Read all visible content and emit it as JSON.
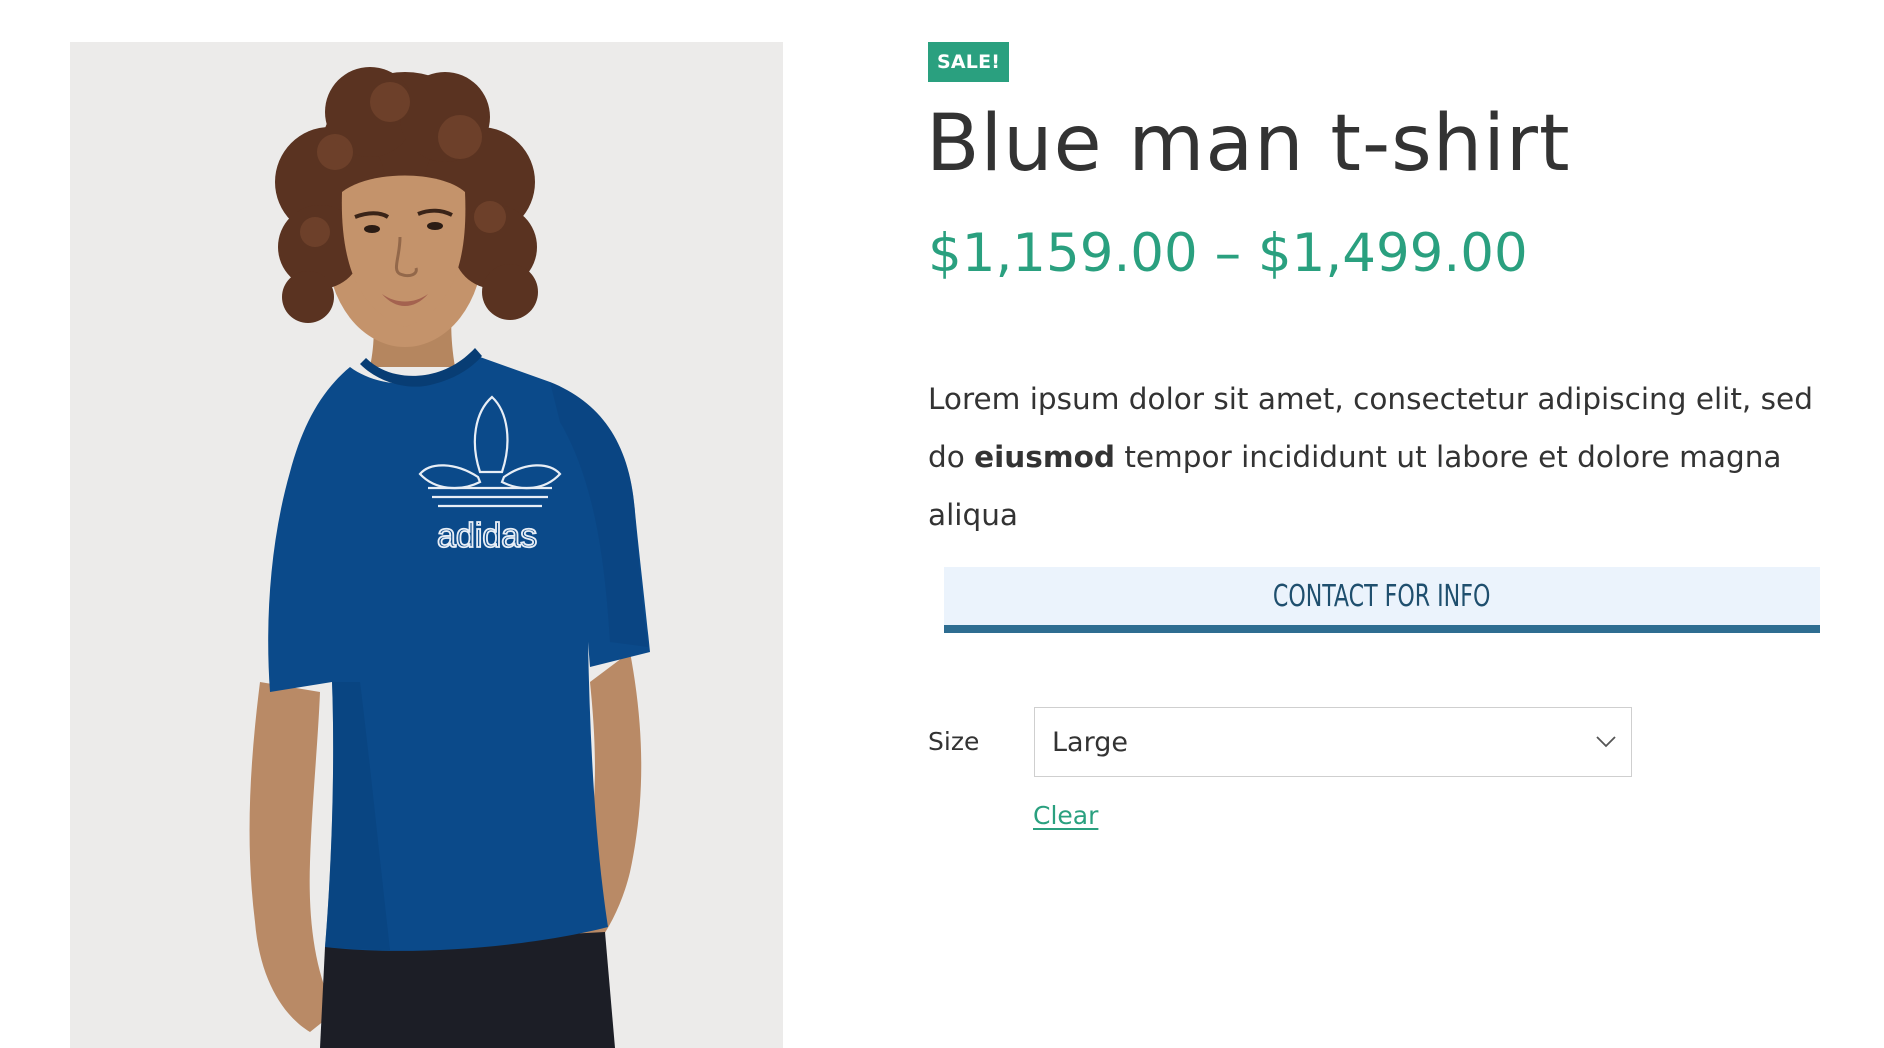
{
  "product": {
    "badge": "SALE!",
    "title": "Blue man t-shirt",
    "price_range": "$1,159.00 – $1,499.00",
    "description": {
      "before_bold": "Lorem ipsum dolor sit amet, consectetur adipiscing elit, sed do ",
      "bold": "eiusmod",
      "after_bold": " tempor incididunt ut labore et dolore magna aliqua"
    },
    "image_logo_text": "adidas"
  },
  "actions": {
    "contact_label": "CONTACT FOR INFO"
  },
  "variations": {
    "size_label": "Size",
    "size_selected": "Large",
    "clear_label": "Clear"
  },
  "colors": {
    "accent": "#2aa07f",
    "button_bg": "#ebf3fc",
    "button_border": "#2e6d91",
    "button_text": "#1f4f6e",
    "shirt": "#0b4a8a",
    "text": "#333333"
  },
  "icons": {
    "select_arrow": "chevron-down-icon"
  }
}
